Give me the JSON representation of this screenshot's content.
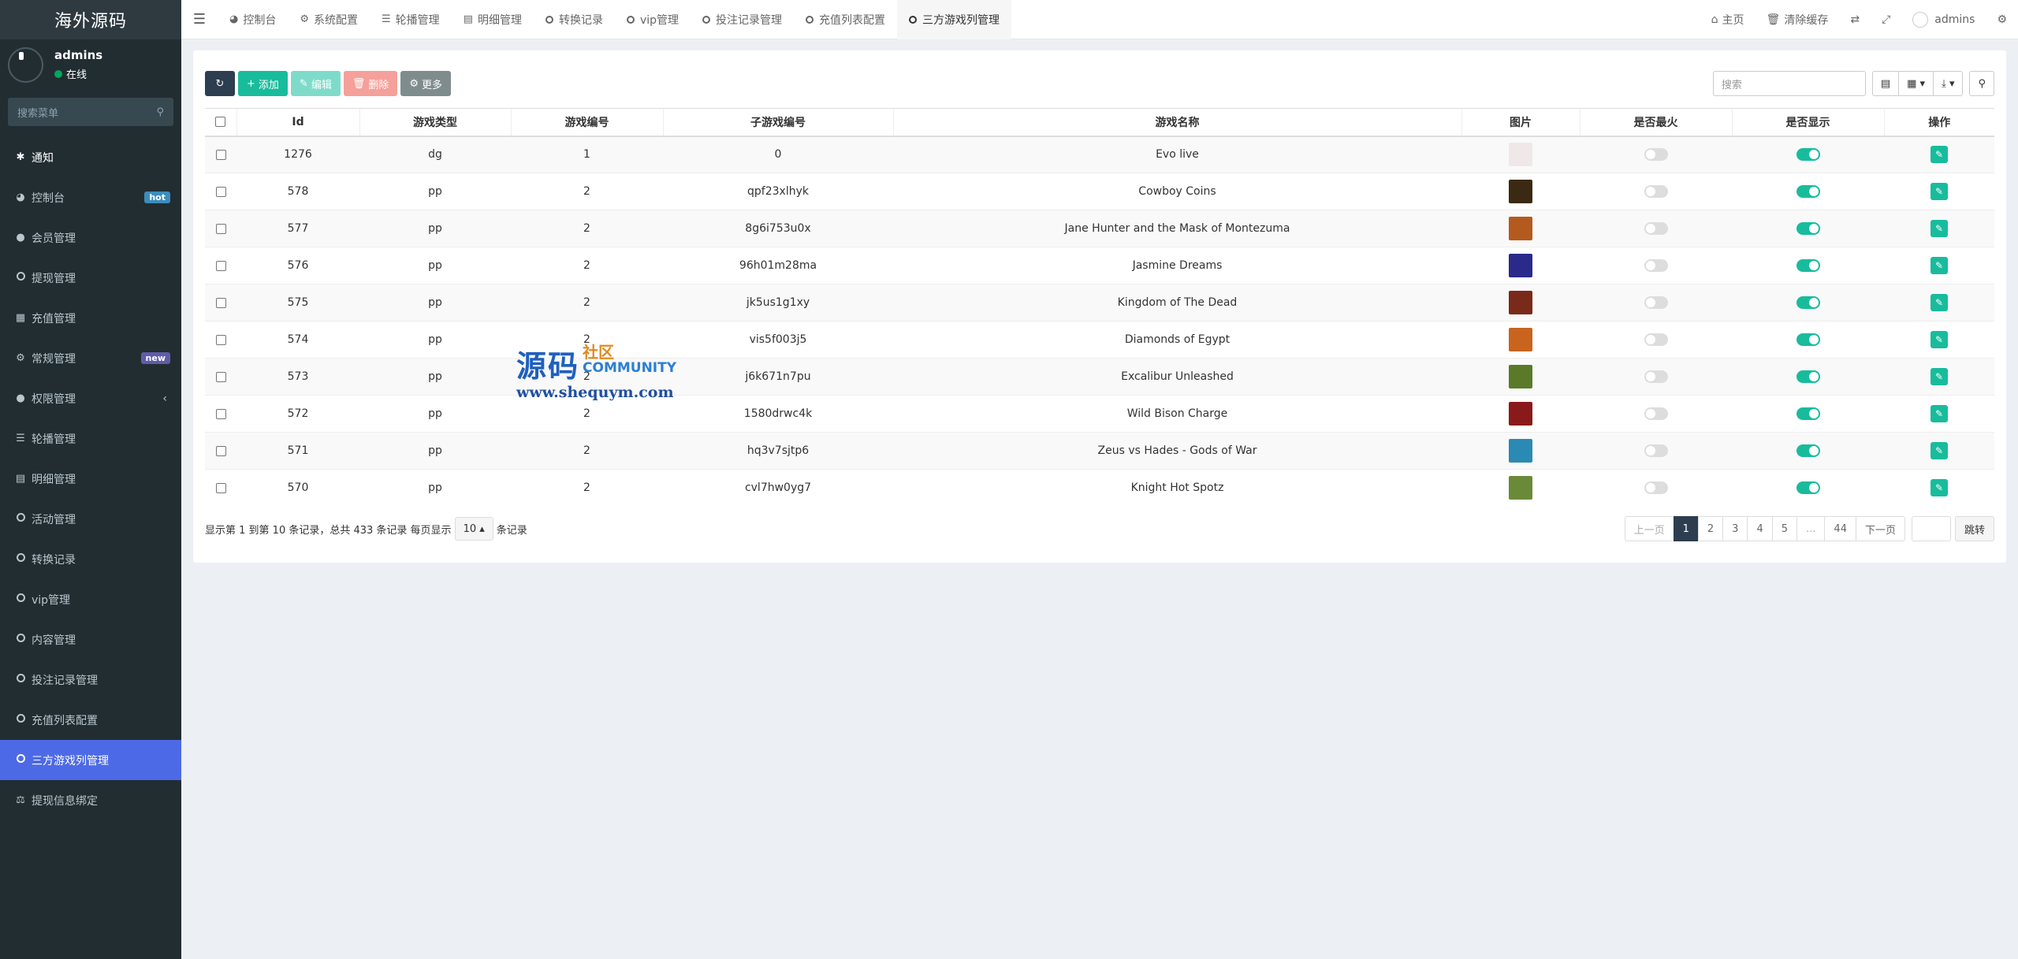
{
  "brand": "海外源码",
  "user": {
    "name": "admins",
    "status": "在线"
  },
  "sidebar": {
    "search_placeholder": "搜索菜单",
    "items": [
      {
        "label": "通知",
        "icon": "gear-icon"
      },
      {
        "label": "控制台",
        "icon": "dashboard-icon",
        "badge": "hot"
      },
      {
        "label": "会员管理",
        "icon": "users-icon"
      },
      {
        "label": "提现管理",
        "icon": "circle-icon"
      },
      {
        "label": "充值管理",
        "icon": "grid-icon"
      },
      {
        "label": "常规管理",
        "icon": "cogs-icon",
        "badge": "new"
      },
      {
        "label": "权限管理",
        "icon": "group-icon"
      },
      {
        "label": "轮播管理",
        "icon": "list-icon"
      },
      {
        "label": "明细管理",
        "icon": "calendar-icon"
      },
      {
        "label": "活动管理",
        "icon": "circle-icon"
      },
      {
        "label": "转换记录",
        "icon": "circle-icon"
      },
      {
        "label": "vip管理",
        "icon": "circle-icon"
      },
      {
        "label": "内容管理",
        "icon": "circle-icon"
      },
      {
        "label": "投注记录管理",
        "icon": "circle-icon"
      },
      {
        "label": "充值列表配置",
        "icon": "circle-icon"
      },
      {
        "label": "三方游戏列管理",
        "icon": "circle-icon"
      },
      {
        "label": "提现信息绑定",
        "icon": "bank-icon"
      }
    ]
  },
  "tabs": [
    {
      "label": "控制台",
      "icon": "dashboard-icon"
    },
    {
      "label": "系统配置",
      "icon": "gear-icon"
    },
    {
      "label": "轮播管理",
      "icon": "list-icon"
    },
    {
      "label": "明细管理",
      "icon": "calendar-icon"
    },
    {
      "label": "转换记录",
      "icon": "circle-icon"
    },
    {
      "label": "vip管理",
      "icon": "circle-icon"
    },
    {
      "label": "投注记录管理",
      "icon": "circle-icon"
    },
    {
      "label": "充值列表配置",
      "icon": "circle-icon"
    },
    {
      "label": "三方游戏列管理",
      "icon": "circle-icon"
    }
  ],
  "top_right": {
    "home": "主页",
    "clear_cache": "清除缓存",
    "username": "admins"
  },
  "toolbar": {
    "add": "添加",
    "edit": "编辑",
    "delete": "删除",
    "more": "更多"
  },
  "search_placeholder": "搜索",
  "table": {
    "headers": [
      "Id",
      "游戏类型",
      "游戏编号",
      "子游戏编号",
      "游戏名称",
      "图片",
      "是否最火",
      "是否显示",
      "操作"
    ],
    "rows": [
      {
        "id": "1276",
        "type": "dg",
        "game_no": "1",
        "sub_no": "0",
        "name": "Evo live",
        "hot": false,
        "show": true,
        "thumb_color": "#f0e8e8"
      },
      {
        "id": "578",
        "type": "pp",
        "game_no": "2",
        "sub_no": "qpf23xlhyk",
        "name": "Cowboy Coins",
        "hot": false,
        "show": true,
        "thumb_color": "#3a2a14"
      },
      {
        "id": "577",
        "type": "pp",
        "game_no": "2",
        "sub_no": "8g6i753u0x",
        "name": "Jane Hunter and the Mask of Montezuma",
        "hot": false,
        "show": true,
        "thumb_color": "#b45a1e"
      },
      {
        "id": "576",
        "type": "pp",
        "game_no": "2",
        "sub_no": "96h01m28ma",
        "name": "Jasmine Dreams",
        "hot": false,
        "show": true,
        "thumb_color": "#2a2a8a"
      },
      {
        "id": "575",
        "type": "pp",
        "game_no": "2",
        "sub_no": "jk5us1g1xy",
        "name": "Kingdom of The Dead",
        "hot": false,
        "show": true,
        "thumb_color": "#7a2a1a"
      },
      {
        "id": "574",
        "type": "pp",
        "game_no": "2",
        "sub_no": "vis5f003j5",
        "name": "Diamonds of Egypt",
        "hot": false,
        "show": true,
        "thumb_color": "#c8641e"
      },
      {
        "id": "573",
        "type": "pp",
        "game_no": "2",
        "sub_no": "j6k671n7pu",
        "name": "Excalibur Unleashed",
        "hot": false,
        "show": true,
        "thumb_color": "#5a7a2a"
      },
      {
        "id": "572",
        "type": "pp",
        "game_no": "2",
        "sub_no": "1580drwc4k",
        "name": "Wild Bison Charge",
        "hot": false,
        "show": true,
        "thumb_color": "#8a1a1a"
      },
      {
        "id": "571",
        "type": "pp",
        "game_no": "2",
        "sub_no": "hq3v7sjtp6",
        "name": "Zeus vs Hades - Gods of War",
        "hot": false,
        "show": true,
        "thumb_color": "#2a8ab4"
      },
      {
        "id": "570",
        "type": "pp",
        "game_no": "2",
        "sub_no": "cvl7hw0yg7",
        "name": "Knight Hot Spotz",
        "hot": false,
        "show": true,
        "thumb_color": "#6a8a3a"
      }
    ]
  },
  "footer": {
    "prefix": "显示第 1 到第 10 条记录，总共 433 条记录 每页显示",
    "page_size": "10",
    "suffix": "条记录"
  },
  "pagination": {
    "prev": "上一页",
    "pages": [
      "1",
      "2",
      "3",
      "4",
      "5",
      "...",
      "44"
    ],
    "next": "下一页",
    "jump": "跳转"
  },
  "watermark": {
    "big": "源码",
    "small": "社区",
    "community": "COMMUNITY",
    "url": "www.shequym.com"
  }
}
